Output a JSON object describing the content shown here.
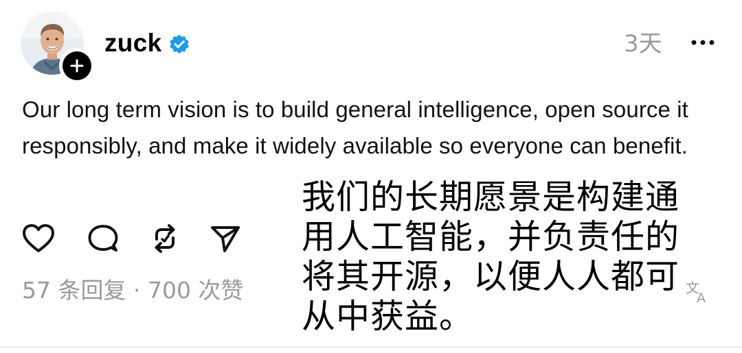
{
  "post": {
    "username": "zuck",
    "timestamp": "3天",
    "text": "Our long term vision is to build general intelligence, open source it responsibly, and make it widely available so everyone can benefit.",
    "stats": "57 条回复 · 700 次赞",
    "translation": "我们的长期愿景是构建通用人工智能，并负责任的将其开源，以便人人都可从中获益。"
  },
  "icons": {
    "verified": "verified-badge-icon",
    "follow": "plus-icon",
    "more": "more-icon",
    "like": "heart-icon",
    "reply": "comment-icon",
    "repost": "repost-icon",
    "share": "send-icon",
    "translate": "translate-icon"
  },
  "colors": {
    "verified": "#1d9bf0",
    "muted": "#9a9a9a"
  }
}
